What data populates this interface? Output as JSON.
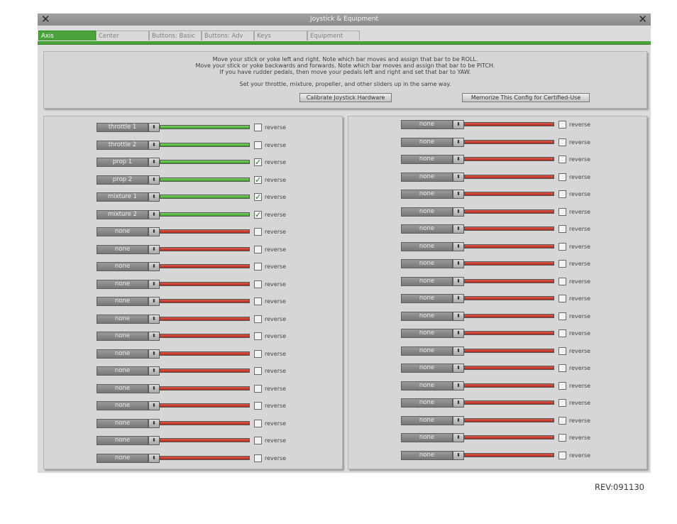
{
  "window": {
    "title": "Joystick & Equipment"
  },
  "tabs": [
    {
      "label": "Axis",
      "active": true
    },
    {
      "label": "Center",
      "active": false
    },
    {
      "label": "Buttons: Basic",
      "active": false
    },
    {
      "label": "Buttons: Adv",
      "active": false
    },
    {
      "label": "Keys",
      "active": false
    },
    {
      "label": "Equipment",
      "active": false
    }
  ],
  "instructions": {
    "line1": "Move your stick or yoke left and right. Note which bar moves and assign that bar to be ROLL.",
    "line2": "Move your stick or yoke backwards and forwards. Note which bar moves and assign that bar to be PITCH.",
    "line3": "If you have rudder pedals, then move your pedals left and right and set that bar to YAW.",
    "line4": "Set your throttle, mixture, propeller, and other sliders up in the same way."
  },
  "buttons": {
    "calibrate": "Calibrate Joystick Hardware",
    "memorize": "Memorize This Config for Certified-Use"
  },
  "reverse_label": "reverse",
  "colors": {
    "green_bar": "#3d9f28",
    "red_bar": "#b12a1e",
    "active_tab": "#4aa33a"
  },
  "left_axes": [
    {
      "assign": "throttle 1",
      "bar": "green",
      "reverse": false
    },
    {
      "assign": "throttle 2",
      "bar": "green",
      "reverse": false
    },
    {
      "assign": "prop 1",
      "bar": "green",
      "reverse": true
    },
    {
      "assign": "prop 2",
      "bar": "green",
      "reverse": true
    },
    {
      "assign": "mixture 1",
      "bar": "green",
      "reverse": true
    },
    {
      "assign": "mixture 2",
      "bar": "green",
      "reverse": true
    },
    {
      "assign": "none",
      "bar": "red",
      "reverse": false
    },
    {
      "assign": "none",
      "bar": "red",
      "reverse": false
    },
    {
      "assign": "none",
      "bar": "red",
      "reverse": false
    },
    {
      "assign": "none",
      "bar": "red",
      "reverse": false
    },
    {
      "assign": "none",
      "bar": "red",
      "reverse": false
    },
    {
      "assign": "none",
      "bar": "red",
      "reverse": false
    },
    {
      "assign": "none",
      "bar": "red",
      "reverse": false
    },
    {
      "assign": "none",
      "bar": "red",
      "reverse": false
    },
    {
      "assign": "none",
      "bar": "red",
      "reverse": false
    },
    {
      "assign": "none",
      "bar": "red",
      "reverse": false
    },
    {
      "assign": "none",
      "bar": "red",
      "reverse": false
    },
    {
      "assign": "none",
      "bar": "red",
      "reverse": false
    },
    {
      "assign": "none",
      "bar": "red",
      "reverse": false
    },
    {
      "assign": "none",
      "bar": "red",
      "reverse": false
    }
  ],
  "right_axes": [
    {
      "assign": "none",
      "bar": "red",
      "reverse": false
    },
    {
      "assign": "none",
      "bar": "red",
      "reverse": false
    },
    {
      "assign": "none",
      "bar": "red",
      "reverse": false
    },
    {
      "assign": "none",
      "bar": "red",
      "reverse": false
    },
    {
      "assign": "none",
      "bar": "red",
      "reverse": false
    },
    {
      "assign": "none",
      "bar": "red",
      "reverse": false
    },
    {
      "assign": "none",
      "bar": "red",
      "reverse": false
    },
    {
      "assign": "none",
      "bar": "red",
      "reverse": false
    },
    {
      "assign": "none",
      "bar": "red",
      "reverse": false
    },
    {
      "assign": "none",
      "bar": "red",
      "reverse": false
    },
    {
      "assign": "none",
      "bar": "red",
      "reverse": false
    },
    {
      "assign": "none",
      "bar": "red",
      "reverse": false
    },
    {
      "assign": "none",
      "bar": "red",
      "reverse": false
    },
    {
      "assign": "none",
      "bar": "red",
      "reverse": false
    },
    {
      "assign": "none",
      "bar": "red",
      "reverse": false
    },
    {
      "assign": "none",
      "bar": "red",
      "reverse": false
    },
    {
      "assign": "none",
      "bar": "red",
      "reverse": false
    },
    {
      "assign": "none",
      "bar": "red",
      "reverse": false
    },
    {
      "assign": "none",
      "bar": "red",
      "reverse": false
    },
    {
      "assign": "none",
      "bar": "red",
      "reverse": false
    }
  ],
  "revision": "REV:091130"
}
